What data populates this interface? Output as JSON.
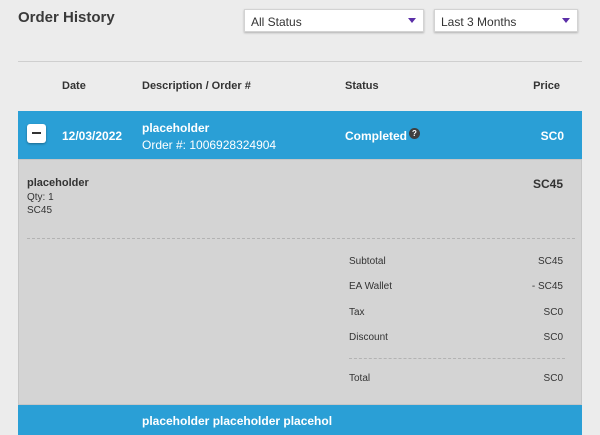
{
  "page": {
    "title": "Order History"
  },
  "filters": {
    "status": {
      "selected": "All Status"
    },
    "range": {
      "selected": "Last 3 Months"
    },
    "accent_color": "#5b2fa8"
  },
  "table": {
    "headers": {
      "date": "Date",
      "description": "Description / Order #",
      "status": "Status",
      "price": "Price"
    }
  },
  "orders": [
    {
      "date": "12/03/2022",
      "description": "placeholder",
      "order_number": "Order #: 1006928324904",
      "status": "Completed",
      "price": "SC0",
      "row_color": "#2a9fd6",
      "expanded": true,
      "items": [
        {
          "name": "placeholder",
          "qty": "Qty: 1",
          "price": "SC45",
          "total": "SC45"
        }
      ],
      "summary": {
        "subtotal_label": "Subtotal",
        "subtotal": "SC45",
        "wallet_label": "EA Wallet",
        "wallet": "- SC45",
        "tax_label": "Tax",
        "tax": "SC0",
        "discount_label": "Discount",
        "discount": "SC0",
        "total_label": "Total",
        "total": "SC0"
      }
    },
    {
      "description": "placeholder placeholder placehol",
      "row_color": "#2a9fd6"
    }
  ]
}
